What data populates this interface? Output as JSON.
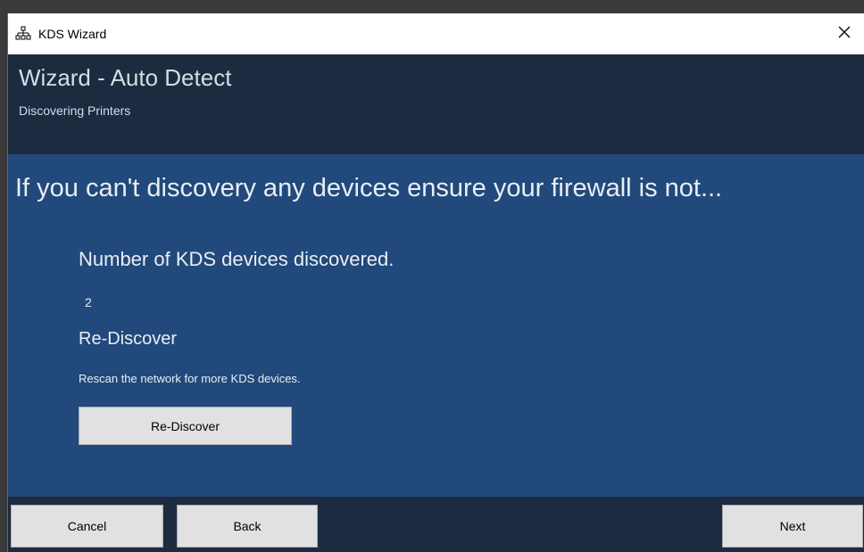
{
  "window": {
    "title": "KDS Wizard",
    "icon": "network-icon",
    "close_icon": "close-icon"
  },
  "header": {
    "title": "Wizard - Auto Detect",
    "subtitle": "Discovering Printers"
  },
  "content": {
    "warning": "If you can't discovery any devices ensure your firewall is not...",
    "count_label": "Number of KDS devices discovered.",
    "count_value": "2",
    "rediscover_heading": "Re-Discover",
    "rediscover_description": "Rescan the network for more KDS devices.",
    "rediscover_button": "Re-Discover"
  },
  "footer": {
    "cancel_label": "Cancel",
    "back_label": "Back",
    "next_label": "Next"
  },
  "colors": {
    "header_bg": "#1c2b40",
    "content_bg": "#21497b",
    "button_bg": "#e1e1e1"
  }
}
